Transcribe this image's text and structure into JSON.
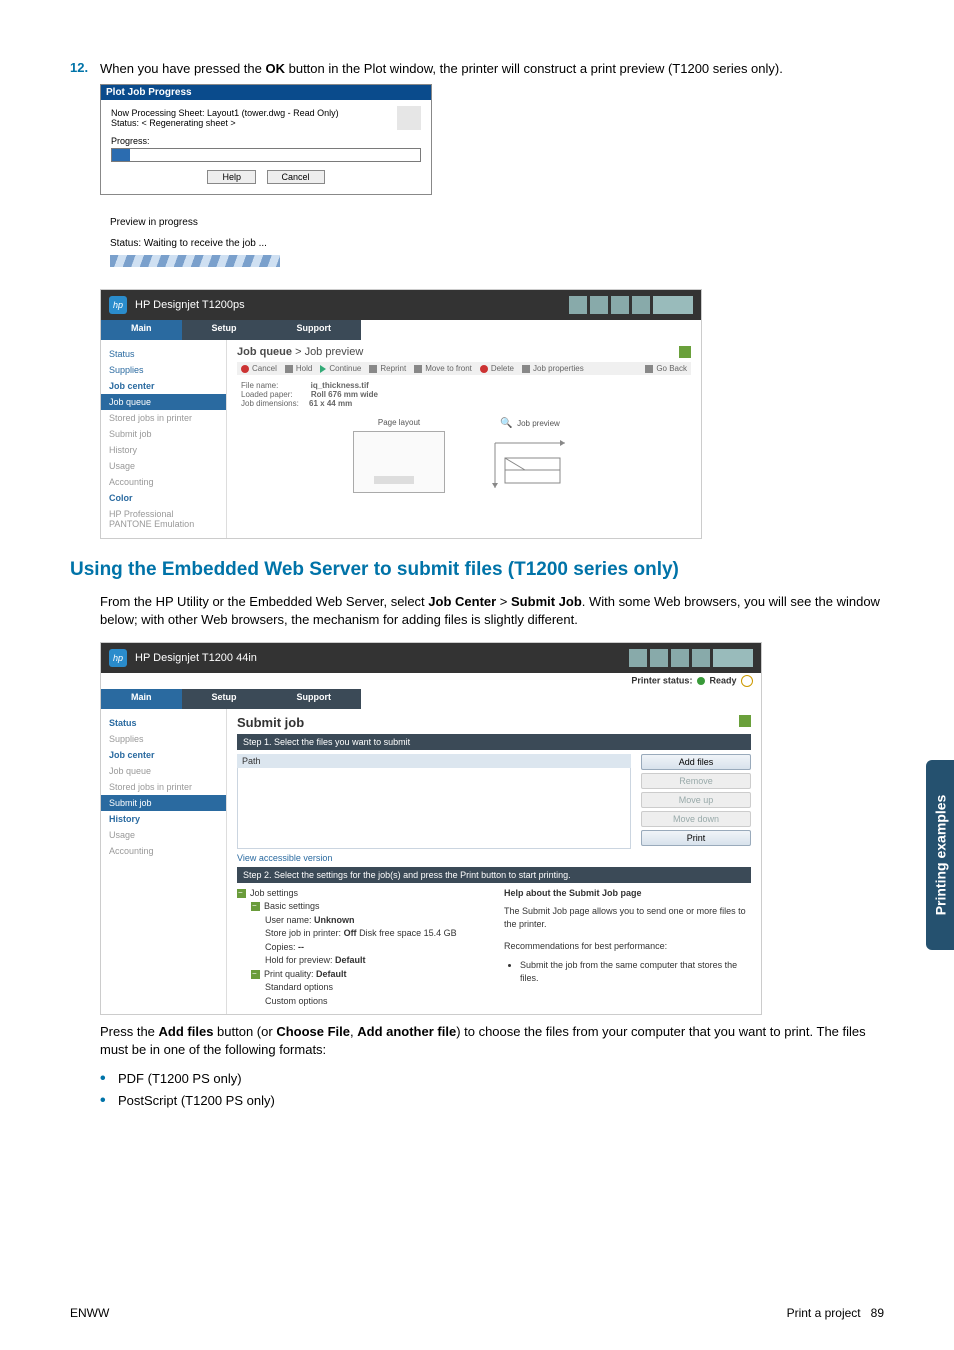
{
  "step": {
    "num": "12.",
    "text_prefix": "When you have pressed the ",
    "bold1": "OK",
    "text_suffix": " button in the Plot window, the printer will construct a print preview (T1200 series only)."
  },
  "plot_dialog": {
    "title": "Plot Job Progress",
    "line1": "Now Processing Sheet: Layout1 (tower.dwg - Read Only)",
    "line2": "Status: < Regenerating sheet >",
    "progress_label": "Progress:",
    "help": "Help",
    "cancel": "Cancel"
  },
  "preview_box": {
    "title": "Preview in progress",
    "status": "Status: Waiting to receive the job ..."
  },
  "ews1": {
    "product": "HP Designjet T1200ps",
    "tabs": {
      "main": "Main",
      "setup": "Setup",
      "support": "Support"
    },
    "side": {
      "status": "Status",
      "supplies": "Supplies",
      "jobcenter": "Job center",
      "jobqueue": "Job queue",
      "stored": "Stored jobs in printer",
      "submit": "Submit job",
      "history": "History",
      "usage": "Usage",
      "accounting": "Accounting",
      "color": "Color",
      "pantone": "HP Professional PANTONE Emulation"
    },
    "crumb_prefix": "Job queue",
    "crumb_sep": " > ",
    "crumb_page": "Job preview",
    "toolbar": {
      "cancel": "Cancel",
      "hold": "Hold",
      "continue": "Continue",
      "reprint": "Reprint",
      "movefront": "Move to front",
      "delete": "Delete",
      "jobprops": "Job properties",
      "goback": "Go Back"
    },
    "detail": {
      "fn_label": "File name:",
      "fn_value": "iq_thickness.tif",
      "paper_label": "Loaded paper:",
      "paper_value": "Roll  676 mm wide",
      "dim_label": "Job dimensions:",
      "dim_value": "61 x 44 mm"
    },
    "figs": {
      "pagelayout": "Page layout",
      "jobpreview": "Job preview"
    }
  },
  "section_title": "Using the Embedded Web Server to submit files (T1200 series only)",
  "para1_prefix": "From the HP Utility or the Embedded Web Server, select ",
  "para1_b1": "Job Center",
  "para1_mid": " > ",
  "para1_b2": "Submit Job",
  "para1_suffix": ". With some Web browsers, you will see the window below; with other Web browsers, the mechanism for adding files is slightly different.",
  "ews2": {
    "product": "HP Designjet T1200 44in",
    "status_label": "Printer status:",
    "status_value": "Ready",
    "tabs": {
      "main": "Main",
      "setup": "Setup",
      "support": "Support"
    },
    "side": {
      "status": "Status",
      "supplies": "Supplies",
      "jobcenter": "Job center",
      "jobqueue": "Job queue",
      "stored": "Stored jobs in printer",
      "submit": "Submit job",
      "history": "History",
      "usage": "Usage",
      "accounting": "Accounting"
    },
    "title": "Submit job",
    "step1": "Step 1. Select the files you want to submit",
    "path": "Path",
    "btns": {
      "add": "Add files",
      "remove": "Remove",
      "moveup": "Move up",
      "movedown": "Move down",
      "print": "Print"
    },
    "accessible": "View accessible version",
    "step2": "Step 2. Select the settings for the job(s) and press the Print button to start printing.",
    "left": {
      "jobsettings": "Job settings",
      "basic": "Basic settings",
      "username": "User name:",
      "username_v": "Unknown",
      "store": "Store job in printer:",
      "store_v": "Off",
      "disk": "Disk free space 15.4 GB",
      "copies": "Copies:",
      "copies_v": "--",
      "hold": "Hold for preview:",
      "hold_v": "Default",
      "pq": "Print quality:",
      "pq_v": "Default",
      "std": "Standard options",
      "custom": "Custom options"
    },
    "right": {
      "help_title": "Help about the Submit Job page",
      "help_text": "The Submit Job page allows you to send one or more files to the printer.",
      "rec": "Recommendations for best performance:",
      "bullet": "Submit the job from the same computer that stores the files."
    }
  },
  "para2_prefix": "Press the ",
  "para2_b1": "Add files",
  "para2_mid1": " button (or ",
  "para2_b2": "Choose File",
  "para2_mid2": ", ",
  "para2_b3": "Add another file",
  "para2_suffix": ") to choose the files from your computer that you want to print. The files must be in one of the following formats:",
  "bullets": {
    "pdf": "PDF (T1200 PS only)",
    "ps": "PostScript (T1200 PS only)"
  },
  "sidetab": "Printing examples",
  "footer": {
    "left": "ENWW",
    "right_label": "Print a project",
    "right_page": "89"
  }
}
